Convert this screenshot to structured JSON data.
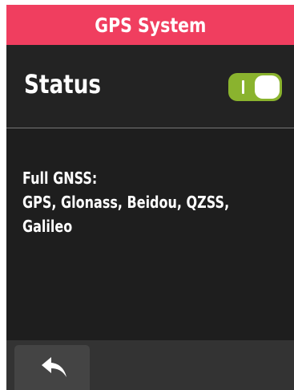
{
  "header": {
    "title": "GPS System",
    "color": "#f03e5f"
  },
  "status": {
    "label": "Status",
    "toggle": {
      "state": "on",
      "color": "#8ab32e"
    }
  },
  "info": {
    "lines": [
      "Full GNSS:",
      "GPS, Glonass,  Beidou, QZSS,",
      "Galileo"
    ]
  },
  "footer": {
    "back_icon": "back-arrow-icon"
  }
}
